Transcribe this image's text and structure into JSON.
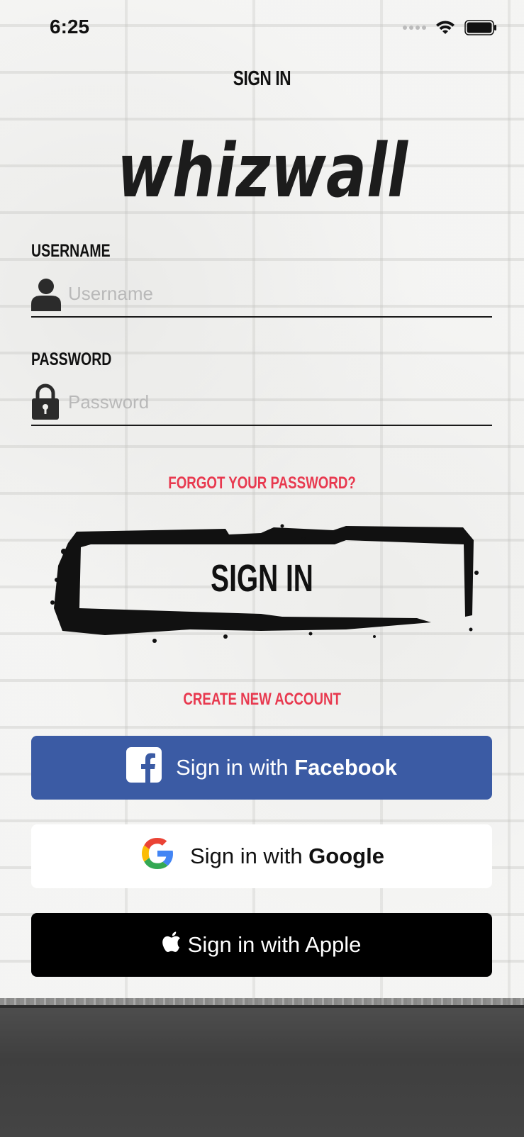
{
  "status_bar": {
    "time": "6:25"
  },
  "header": {
    "title": "SIGN IN"
  },
  "logo": {
    "text": "whizwall"
  },
  "form": {
    "username_label": "USERNAME",
    "username_placeholder": "Username",
    "username_value": "",
    "password_label": "PASSWORD",
    "password_placeholder": "Password",
    "password_value": ""
  },
  "links": {
    "forgot_password": "FORGOT YOUR PASSWORD?",
    "create_account": "CREATE NEW ACCOUNT"
  },
  "primary_button": {
    "label": "SIGN IN"
  },
  "social": {
    "facebook_prefix": "Sign in with ",
    "facebook_brand": "Facebook",
    "google_prefix": "Sign in with ",
    "google_brand": "Google",
    "apple_label": "Sign in with Apple"
  },
  "colors": {
    "link_red": "#e8394f",
    "facebook_blue": "#3b5ba4",
    "apple_black": "#000000",
    "google_white": "#ffffff"
  },
  "icons": {
    "username": "person-icon",
    "password": "lock-icon",
    "facebook": "facebook-icon",
    "google": "google-icon",
    "apple": "apple-icon"
  }
}
